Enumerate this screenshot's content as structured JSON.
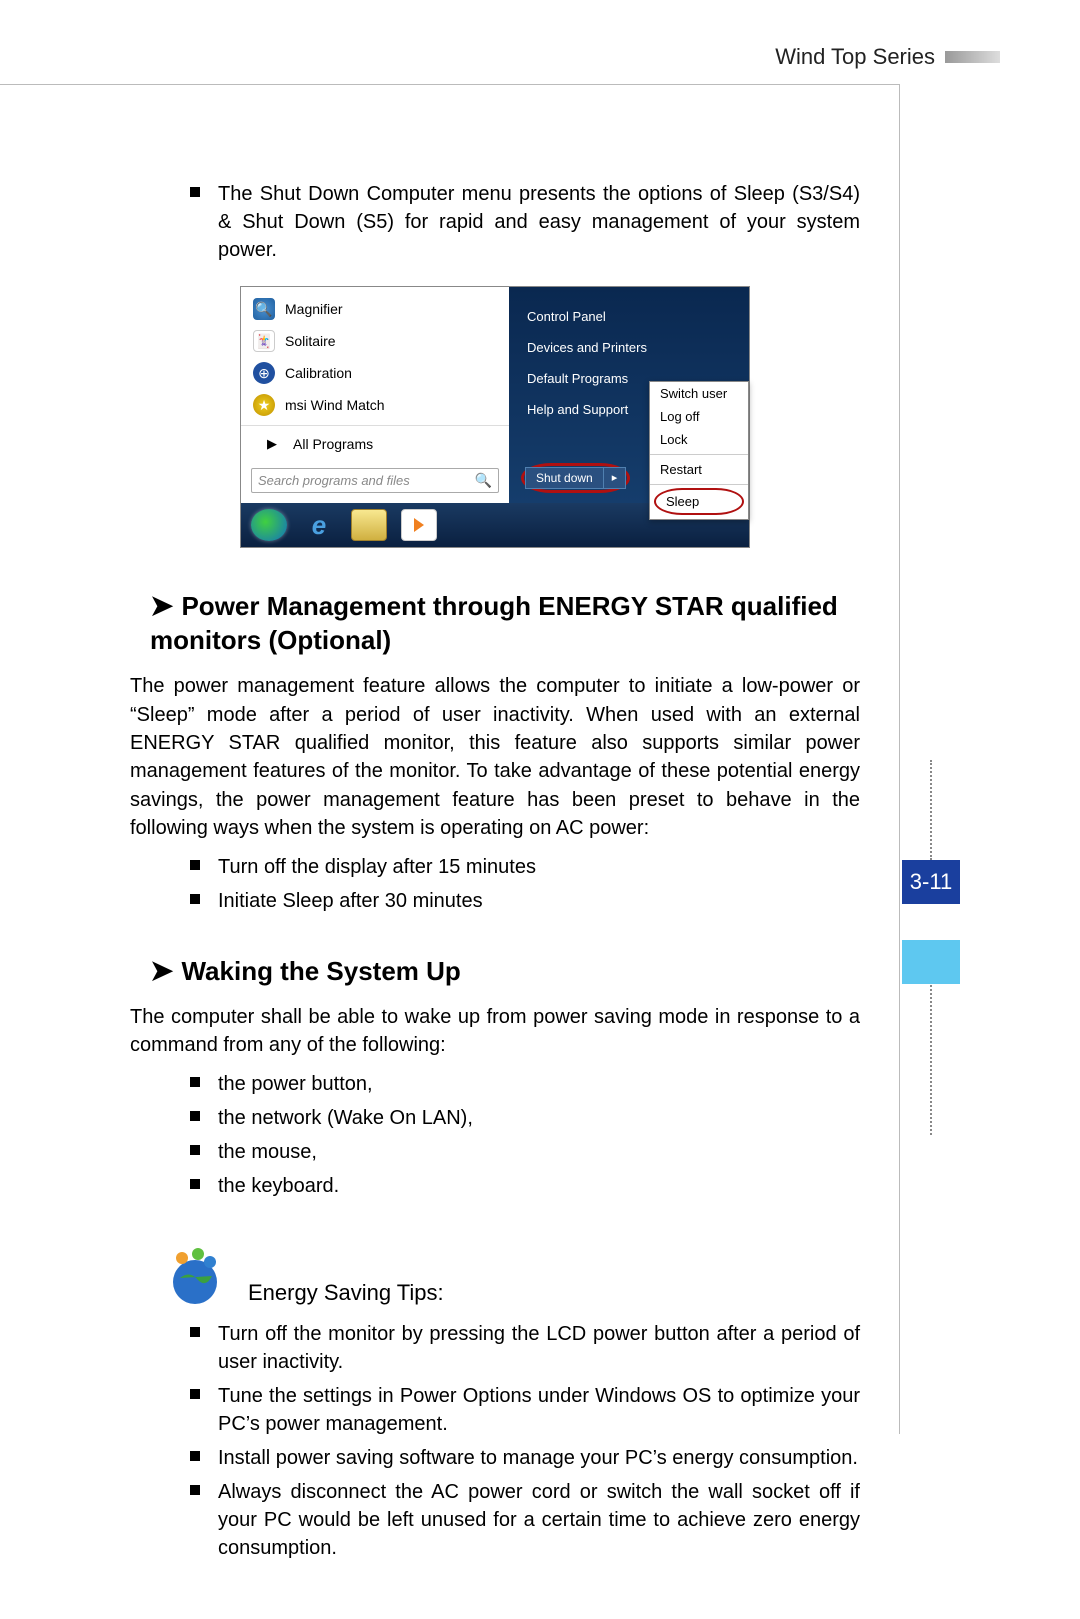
{
  "header": {
    "title": "Wind Top Series"
  },
  "page_number": "3-11",
  "intro_bullet": "The Shut Down Computer menu presents the options of Sleep (S3/S4) & Shut Down (S5) for rapid and easy management of your system power.",
  "screenshot": {
    "left_items": [
      {
        "icon": "magnifier",
        "label": "Magnifier"
      },
      {
        "icon": "solitaire",
        "label": "Solitaire"
      },
      {
        "icon": "calibration",
        "label": "Calibration"
      },
      {
        "icon": "wind-match",
        "label": "msi Wind Match"
      }
    ],
    "all_programs": "All Programs",
    "search_placeholder": "Search programs and files",
    "right_links": [
      "Control Panel",
      "Devices and Printers",
      "Default Programs",
      "Help and Support"
    ],
    "shutdown_label": "Shut down",
    "popup": {
      "items_top": [
        "Switch user",
        "Log off",
        "Lock"
      ],
      "items_mid": [
        "Restart"
      ],
      "items_bot": [
        "Sleep"
      ]
    }
  },
  "section1": {
    "title": "Power Management through ENERGY STAR qualified monitors (Optional)",
    "para": "The power management feature allows the computer to initiate a low-power or “Sleep” mode after a period of user inactivity. When used with an external ENERGY STAR qualified monitor, this feature also supports similar power management features of the monitor. To take advantage of these potential energy savings, the power management feature has been preset to behave in the following ways when the system is operating on AC power:",
    "bullets": [
      "Turn off the display after 15 minutes",
      "Initiate Sleep after 30 minutes"
    ]
  },
  "section2": {
    "title": "Waking the System Up",
    "para": "The computer shall be able to wake up from power saving mode in response to a command from any of the following:",
    "bullets": [
      "the power button,",
      "the network (Wake On LAN),",
      "the mouse,",
      "the keyboard."
    ]
  },
  "energy": {
    "title": "Energy Saving Tips:",
    "bullets": [
      "Turn off the monitor by pressing the LCD power button after a period of user inactivity.",
      "Tune the settings in Power Options under Windows OS to optimize your PC’s power management.",
      "Install power saving software to manage your PC’s energy consumption.",
      "Always disconnect the AC power cord or switch the wall socket off if your PC would be left unused for a certain time to achieve zero energy consumption."
    ]
  }
}
